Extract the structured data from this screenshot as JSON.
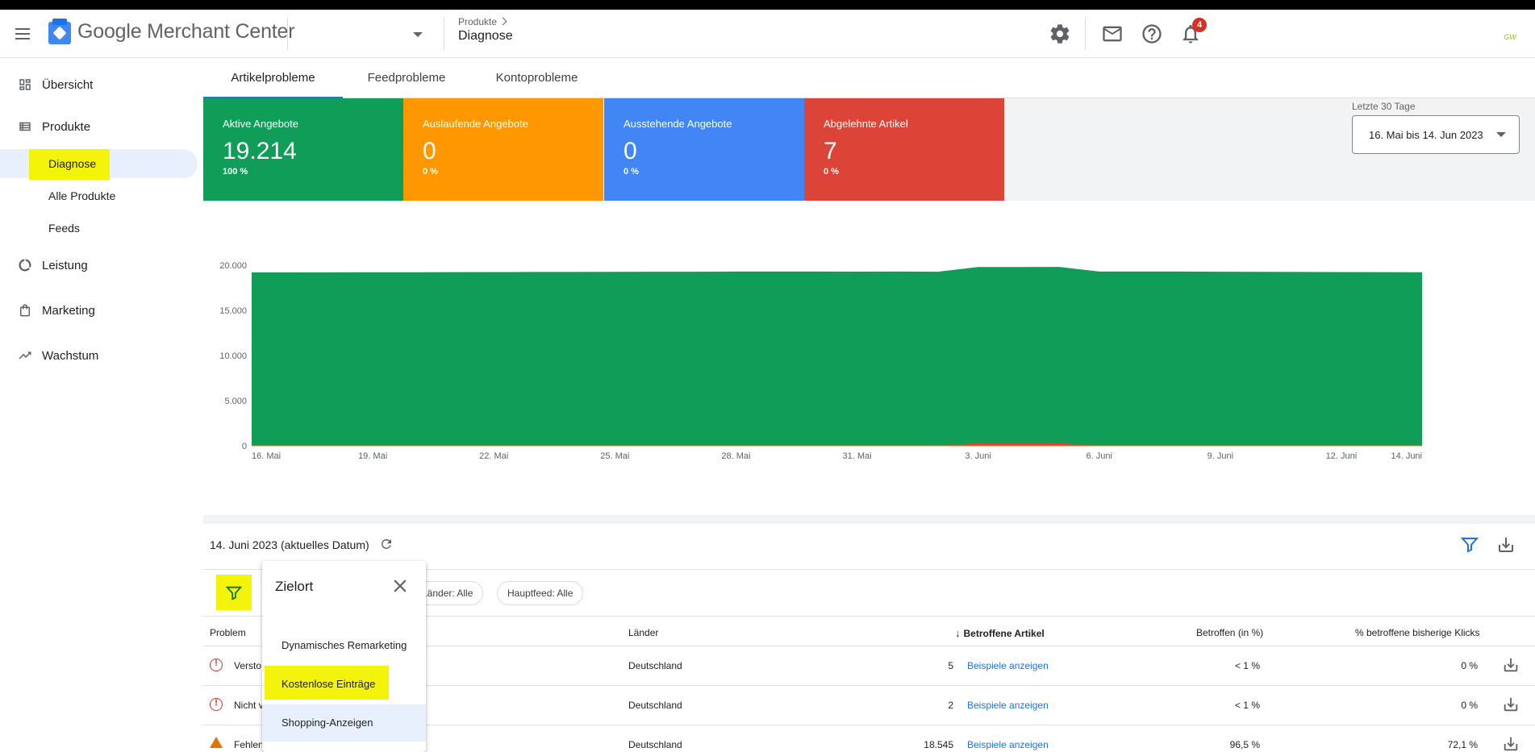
{
  "header": {
    "logo_google": "Google",
    "logo_product": "Merchant Center",
    "breadcrumb_parent": "Produkte",
    "breadcrumb_current": "Diagnose",
    "notification_count": "4",
    "avatar_text": "GW"
  },
  "sidebar": {
    "items": [
      {
        "label": "Übersicht",
        "icon": "dashboard-icon"
      },
      {
        "label": "Produkte",
        "icon": "list-icon"
      },
      {
        "label": "Diagnose",
        "active": true
      },
      {
        "label": "Alle Produkte"
      },
      {
        "label": "Feeds"
      },
      {
        "label": "Leistung",
        "icon": "donut-icon"
      },
      {
        "label": "Marketing",
        "icon": "bag-icon"
      },
      {
        "label": "Wachstum",
        "icon": "trend-icon"
      }
    ]
  },
  "tabs": [
    {
      "label": "Artikelprobleme",
      "active": true
    },
    {
      "label": "Feedprobleme"
    },
    {
      "label": "Kontoprobleme"
    }
  ],
  "stats": [
    {
      "label": "Aktive Angebote",
      "value": "19.214",
      "pct": "100 %",
      "color": "#0f9d58"
    },
    {
      "label": "Auslaufende Angebote",
      "value": "0",
      "pct": "0 %",
      "color": "#ff9800"
    },
    {
      "label": "Ausstehende Angebote",
      "value": "0",
      "pct": "0 %",
      "color": "#4285f4"
    },
    {
      "label": "Abgelehnte Artikel",
      "value": "7",
      "pct": "0 %",
      "color": "#db4437"
    }
  ],
  "date_range": {
    "label": "Letzte 30 Tage",
    "value": "16. Mai bis 14. Jun 2023"
  },
  "chart_data": {
    "type": "area",
    "x": [
      "16. Mai",
      "17. Mai",
      "18. Mai",
      "19. Mai",
      "20. Mai",
      "21. Mai",
      "22. Mai",
      "23. Mai",
      "24. Mai",
      "25. Mai",
      "26. Mai",
      "27. Mai",
      "28. Mai",
      "29. Mai",
      "30. Mai",
      "31. Mai",
      "1. Juni",
      "2. Juni",
      "3. Juni",
      "4. Juni",
      "5. Juni",
      "6. Juni",
      "7. Juni",
      "8. Juni",
      "9. Juni",
      "10. Juni",
      "11. Juni",
      "12. Juni",
      "13. Juni",
      "14. Juni"
    ],
    "x_ticks": [
      "16. Mai",
      "19. Mai",
      "22. Mai",
      "25. Mai",
      "28. Mai",
      "31. Mai",
      "3. Juni",
      "6. Juni",
      "9. Juni",
      "12. Juni",
      "14. Juni"
    ],
    "y_ticks": [
      "0",
      "5.000",
      "10.000",
      "15.000",
      "20.000"
    ],
    "ylim": [
      0,
      20000
    ],
    "series": [
      {
        "color": "#0f9d58",
        "values": [
          19200,
          19200,
          19210,
          19220,
          19220,
          19230,
          19240,
          19250,
          19250,
          19260,
          19270,
          19280,
          19300,
          19300,
          19300,
          19290,
          19300,
          19280,
          19800,
          19800,
          19810,
          19300,
          19300,
          19300,
          19280,
          19260,
          19250,
          19240,
          19230,
          19214
        ]
      },
      {
        "color": "#db4437",
        "values": [
          0,
          0,
          0,
          0,
          0,
          0,
          0,
          0,
          0,
          0,
          0,
          0,
          0,
          0,
          0,
          0,
          0,
          0,
          300,
          300,
          300,
          0,
          0,
          0,
          0,
          0,
          0,
          0,
          0,
          7
        ]
      }
    ]
  },
  "panel": {
    "date": "14. Juni 2023 (aktuelles Datum)",
    "chips": [
      "Länder: Alle",
      "Hauptfeed: Alle"
    ],
    "columns": {
      "problem": "Problem",
      "countries": "Länder",
      "affected": "Betroffene Artikel",
      "affected_pct": "Betroffen (in %)",
      "clicks_pct": "% betroffene bisherige Klicks"
    },
    "rows": [
      {
        "problem": "Versto",
        "type": "error",
        "country": "Deutschland",
        "count": "5",
        "link": "Beispiele anzeigen",
        "pct": "< 1 %",
        "clicks": "0 %"
      },
      {
        "problem": "Nicht v",
        "type": "error",
        "country": "Deutschland",
        "count": "2",
        "link": "Beispiele anzeigen",
        "pct": "< 1 %",
        "clicks": "0 %"
      },
      {
        "problem": "Fehlen",
        "type": "warning",
        "country": "Deutschland",
        "count": "18.545",
        "link": "Beispiele anzeigen",
        "pct": "96,5 %",
        "clicks": "72,1 %"
      }
    ]
  },
  "popup": {
    "title": "Zielort",
    "items": [
      "Dynamisches Remarketing",
      "Kostenlose Einträge",
      "Shopping-Anzeigen"
    ]
  }
}
